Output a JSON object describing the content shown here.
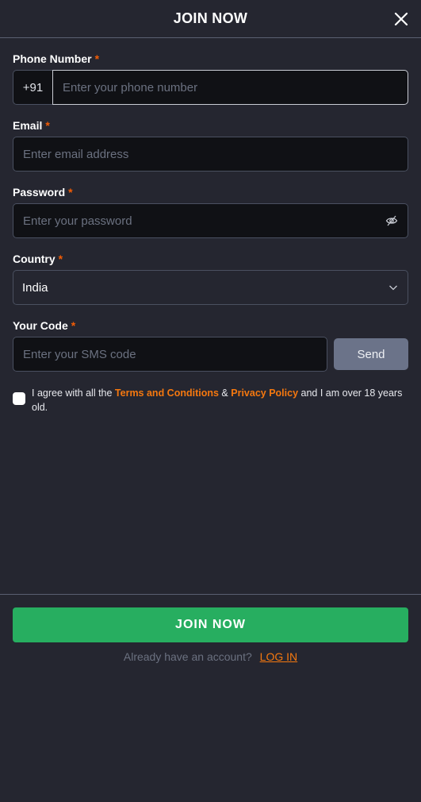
{
  "header": {
    "title": "JOIN NOW",
    "close_icon": "close-icon"
  },
  "form": {
    "phone": {
      "label": "Phone Number",
      "required": "*",
      "prefix": "+91",
      "placeholder": "Enter your phone number",
      "value": ""
    },
    "email": {
      "label": "Email",
      "required": "*",
      "placeholder": "Enter email address",
      "value": ""
    },
    "password": {
      "label": "Password",
      "required": "*",
      "placeholder": "Enter your password",
      "value": "",
      "toggle_icon": "eye-off-icon"
    },
    "country": {
      "label": "Country",
      "required": "*",
      "selected": "India",
      "icon": "chevron-down-icon"
    },
    "code": {
      "label": "Your Code",
      "required": "*",
      "placeholder": "Enter your SMS code",
      "value": "",
      "send_label": "Send"
    },
    "agreement": {
      "checked": false,
      "text_before": "I agree with all the ",
      "terms_link": "Terms and Conditions",
      "amp": " & ",
      "privacy_link": "Privacy Policy",
      "text_after": " and I am over 18 years old."
    }
  },
  "footer": {
    "join_label": "JOIN NOW",
    "login_prompt": "Already have an account?",
    "login_link": "LOG IN"
  },
  "colors": {
    "accent": "#f5780f",
    "primary_button": "#27ae60",
    "background": "#252630",
    "send_button": "#6b7389"
  }
}
